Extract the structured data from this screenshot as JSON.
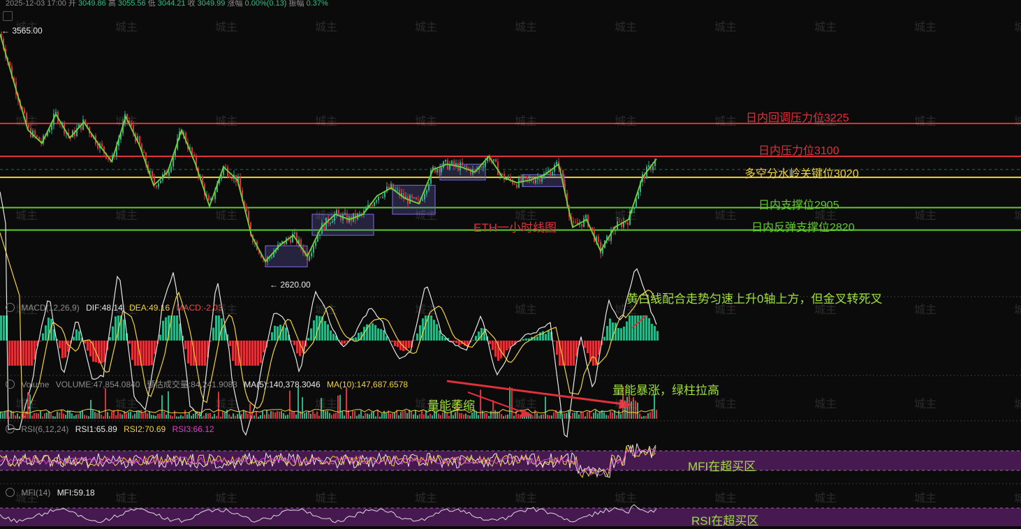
{
  "header": {
    "date": "2025-12-03 17:00",
    "open_label": "开",
    "open": "3049.86",
    "high_label": "高",
    "high": "3055.56",
    "low_label": "低",
    "low": "3044.21",
    "close_label": "收",
    "close": "3049.99",
    "change_label": "涨幅",
    "change": "0.00%(0.13)",
    "amp_label": "振幅",
    "amp": "0.37%"
  },
  "price_marks": {
    "high": "← 3565.00",
    "low": "← 2620.00"
  },
  "chart_title": "ETH一小时线图",
  "levels": [
    {
      "label": "日内回调压力位3225",
      "value": 3225,
      "color": "#e0303a"
    },
    {
      "label": "日内压力位3100",
      "value": 3100,
      "color": "#e0303a"
    },
    {
      "label": "多空分水岭关键位3020",
      "value": 3020,
      "color": "#f2d33b"
    },
    {
      "label": "日内支撑位2905",
      "value": 2905,
      "color": "#5fce2a"
    },
    {
      "label": "日内反弹支撑位2820",
      "value": 2820,
      "color": "#5fce2a"
    }
  ],
  "macd": {
    "name": "MACD(12,26,9)",
    "dif": "DIF:48.14",
    "dea": "DEA:49.16",
    "macd": "MACD:-2.03"
  },
  "volume": {
    "name": "Volume",
    "volume": "VOLUME:47,854.0840",
    "est": "预估成交量:84,241.9083",
    "ma5": "MA(5):140,378.3046",
    "ma10": "MA(10):147,687.6578"
  },
  "rsi": {
    "name": "RSI(6,12,24)",
    "rsi1": "RSI1:65.89",
    "rsi2": "RSI2:70.69",
    "rsi3": "RSI3:66.12"
  },
  "mfi": {
    "name": "MFI(14)",
    "mfi": "MFI:59.18"
  },
  "annotations": {
    "macd_note": "黄白线配合走势匀速上升0轴上方，但金叉转死叉",
    "vol_shrink": "量能萎缩",
    "vol_surge": "量能暴涨，绿柱拉高",
    "rsi_zone": "MFI在超买区",
    "mfi_zone": "RSI在超买区"
  },
  "watermark": "城主",
  "colors": {
    "bg": "#0b0b0b",
    "up": "#2bb38a",
    "down": "#e0303a",
    "box": "#6a60c8"
  },
  "chart_data": [
    {
      "type": "line",
      "title": "ETH一小时线图",
      "ylim": [
        2600,
        3580
      ],
      "x": [
        0,
        20,
        40,
        60,
        80,
        100,
        120,
        140,
        160,
        180,
        200,
        220,
        240,
        260,
        280,
        300,
        320,
        340,
        360,
        380,
        400,
        420,
        440,
        460,
        480,
        500,
        520,
        540,
        560,
        580,
        600,
        620,
        640,
        660,
        680,
        700,
        720,
        740,
        760,
        780,
        800,
        820,
        840,
        860,
        880,
        900,
        920,
        940
      ],
      "series": [
        {
          "values": [
            3565,
            3380,
            3200,
            3150,
            3260,
            3170,
            3230,
            3150,
            3080,
            3250,
            3140,
            2990,
            3040,
            3200,
            3070,
            2910,
            3060,
            3010,
            2800,
            2700,
            2760,
            2800,
            2720,
            2830,
            2880,
            2860,
            2880,
            2950,
            2980,
            2940,
            2920,
            3050,
            3070,
            3060,
            3040,
            3100,
            3020,
            3000,
            3010,
            3030,
            3070,
            2830,
            2860,
            2740,
            2830,
            2860,
            3020,
            3090
          ]
        }
      ],
      "levels": [
        3225,
        3100,
        3020,
        2905,
        2820
      ],
      "marks": {
        "high": 3565,
        "low": 2620
      }
    },
    {
      "type": "line",
      "name": "MACD(12,26,9)",
      "series": [
        {
          "name": "DIF",
          "last": 48.14
        },
        {
          "name": "DEA",
          "last": 49.16
        },
        {
          "name": "MACD",
          "last": -2.03
        }
      ]
    },
    {
      "type": "bar",
      "name": "Volume",
      "series": [
        {
          "name": "VOLUME",
          "last": 47854.084
        },
        {
          "name": "MA(5)",
          "last": 140378.3046
        },
        {
          "name": "MA(10)",
          "last": 147687.6578
        }
      ]
    },
    {
      "type": "line",
      "name": "RSI(6,12,24)",
      "series": [
        {
          "name": "RSI1",
          "last": 65.89
        },
        {
          "name": "RSI2",
          "last": 70.69
        },
        {
          "name": "RSI3",
          "last": 66.12
        }
      ]
    },
    {
      "type": "line",
      "name": "MFI(14)",
      "series": [
        {
          "name": "MFI",
          "last": 59.18
        }
      ]
    }
  ]
}
